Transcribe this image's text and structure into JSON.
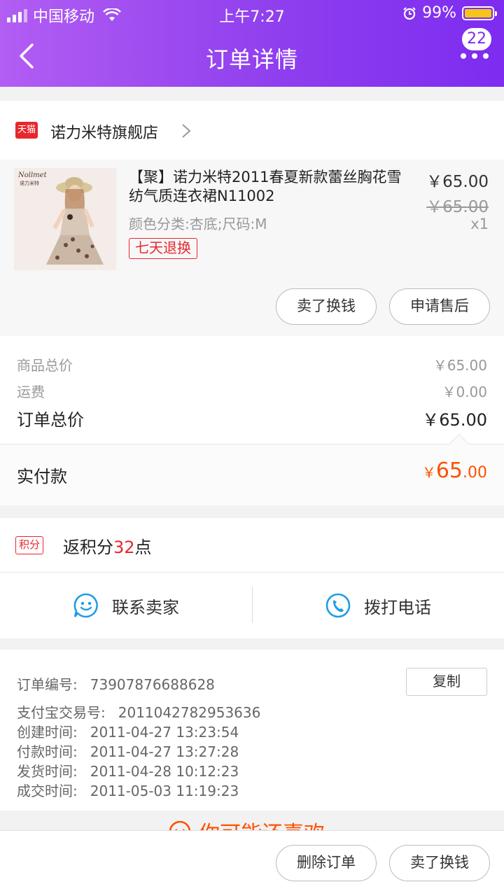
{
  "status_bar": {
    "carrier": "中国移动",
    "time": "上午7:27",
    "battery": "99%"
  },
  "nav": {
    "title": "订单详情",
    "badge_count": "22"
  },
  "shop": {
    "logo_text": "天猫",
    "name": "诺力米特旗舰店"
  },
  "product": {
    "title": "【聚】诺力米特2011春夏新款蕾丝胸花雪纺气质连衣裙N11002",
    "sku": "颜色分类:杏底;尺码:M",
    "tag": "七天退换",
    "price": "￥65.00",
    "original_price": "￥65.00",
    "quantity": "x1",
    "image_brand": "Nollmet",
    "image_brand_cn": "诺力米特",
    "actions": [
      "卖了换钱",
      "申请售后"
    ]
  },
  "totals": {
    "goods_label": "商品总价",
    "goods_value": "￥65.00",
    "shipping_label": "运费",
    "shipping_value": "￥0.00",
    "order_label": "订单总价",
    "order_value": "￥65.00",
    "paid_label": "实付款",
    "paid_currency": "￥",
    "paid_int": "65",
    "paid_dec": ".00"
  },
  "points": {
    "tag": "积分",
    "prefix": "返积分",
    "value": "32",
    "suffix": "点"
  },
  "contact": {
    "seller_label": "联系卖家",
    "phone_label": "拨打电话"
  },
  "order_info": {
    "copy_label": "复制",
    "rows": [
      {
        "label": "订单编号:",
        "value": "73907876688628"
      },
      {
        "label": "支付宝交易号:",
        "value": "2011042782953636"
      },
      {
        "label": "创建时间:",
        "value": "2011-04-27 13:23:54"
      },
      {
        "label": "付款时间:",
        "value": "2011-04-27 13:27:28"
      },
      {
        "label": "发货时间:",
        "value": "2011-04-28 10:12:23"
      },
      {
        "label": "成交时间:",
        "value": "2011-05-03 11:19:23"
      }
    ]
  },
  "recommend": {
    "title": "你可能还喜欢"
  },
  "bottom_bar": {
    "delete_label": "删除订单",
    "sell_label": "卖了换钱"
  },
  "colors": {
    "header_gradient_start": "#b25df3",
    "header_gradient_end": "#7d2cf0",
    "accent_red": "#e7272e",
    "price_orange": "#ff5000",
    "icon_blue": "#1e9de8"
  }
}
